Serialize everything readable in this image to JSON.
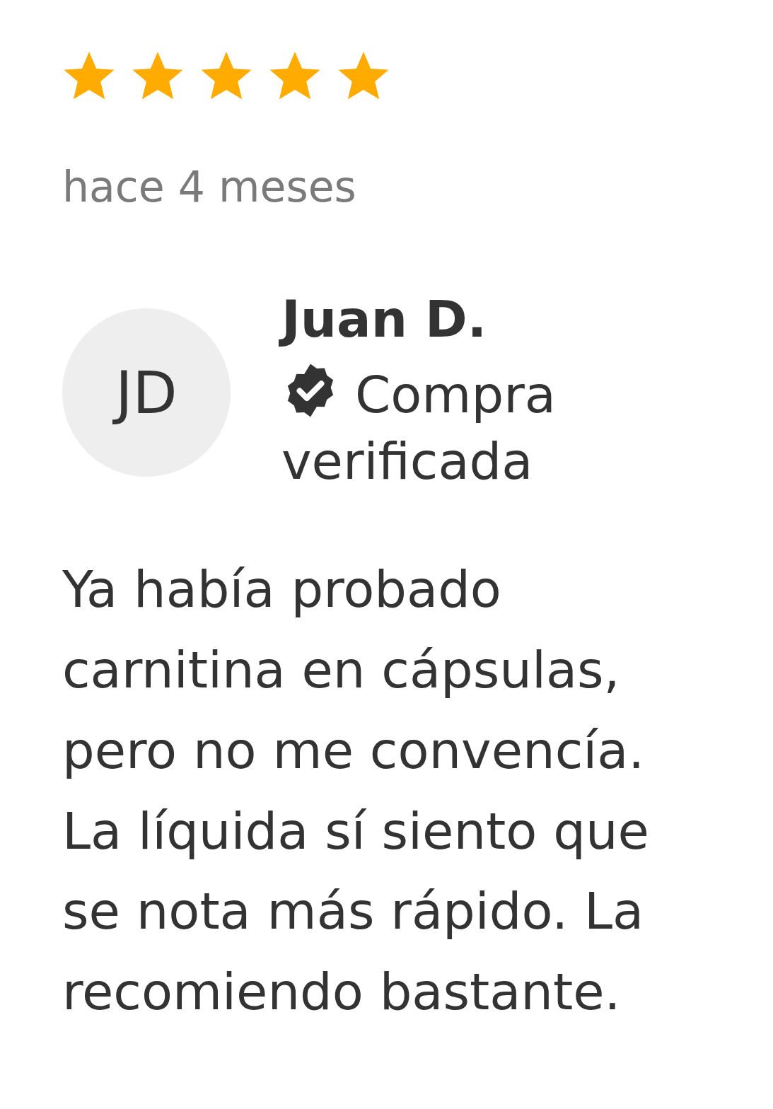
{
  "review": {
    "stars": 5,
    "date": "hace 4 meses",
    "avatar_initials": "JD",
    "author": "Juan D.",
    "verified": true,
    "verified_label": "Compra verificada",
    "text": "Ya había probado carnitina en cápsulas, pero no me convencía. La líquida sí siento que se nota más rápido. La recomiendo bastante."
  }
}
